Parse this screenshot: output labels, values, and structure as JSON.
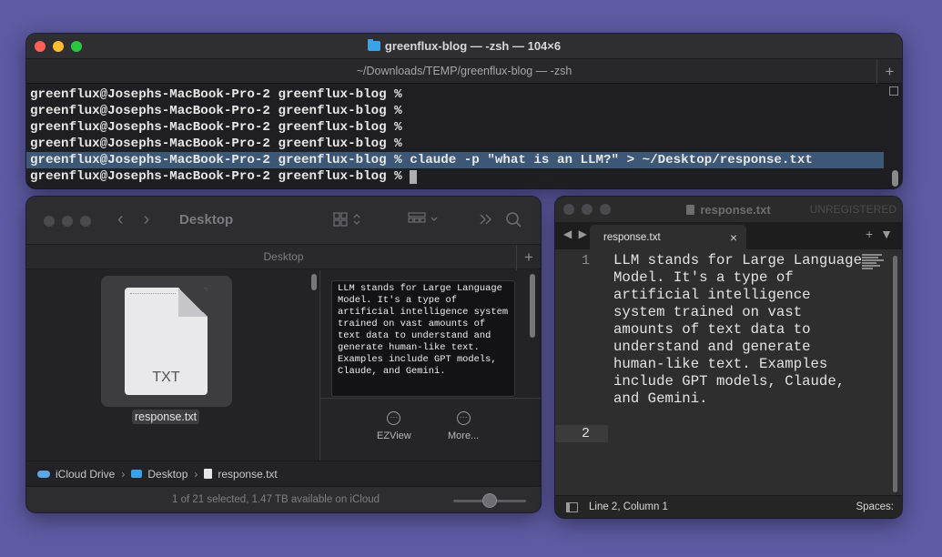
{
  "terminal": {
    "title": "greenflux-blog — -zsh — 104×6",
    "tab": "~/Downloads/TEMP/greenflux-blog — -zsh",
    "prompt": "greenflux@Josephs-MacBook-Pro-2 greenflux-blog % ",
    "command": "claude -p \"what is an LLM?\" > ~/Desktop/response.txt",
    "new_tab_glyph": "+"
  },
  "finder": {
    "title": "Desktop",
    "tab": "Desktop",
    "back_glyph": "‹",
    "forward_glyph": "›",
    "new_tab_glyph": "+",
    "file": {
      "icon_label": "TXT",
      "name": "response.txt"
    },
    "preview_text": "LLM stands for Large Language Model. It's a type of artificial intelligence system trained on vast amounts of text data to understand and generate human-like text. Examples include GPT models, Claude, and Gemini.",
    "actions": [
      {
        "label": "EZView",
        "icon": "ellipsis-circle-icon",
        "glyph": "···"
      },
      {
        "label": "More...",
        "icon": "ellipsis-circle-icon",
        "glyph": "···"
      }
    ],
    "path": {
      "root": "iCloud Drive",
      "folder": "Desktop",
      "file": "response.txt",
      "sep": "›"
    },
    "status": "1 of 21 selected, 1.47 TB available on iCloud",
    "zoom": 0.5
  },
  "editor": {
    "title": "response.txt",
    "badge": "UNREGISTERED",
    "nav_glyph": "◀ ▶",
    "tab": "response.txt",
    "close_glyph": "×",
    "add_glyph": "+",
    "menu_glyph": "▼",
    "lines": [
      {
        "number": "1",
        "text": "LLM stands for Large Language Model. It's a type of artificial intelligence system trained on vast amounts of text data to understand and generate human-like text. Examples include GPT models, Claude, and Gemini."
      },
      {
        "number": "2",
        "text": ""
      }
    ],
    "status_position": "Line 2, Column 1",
    "status_spaces": "Spaces:"
  },
  "colors": {
    "desktop": "#5e5aa3",
    "selection": "#3d5876",
    "folder": "#3aa3e8"
  }
}
